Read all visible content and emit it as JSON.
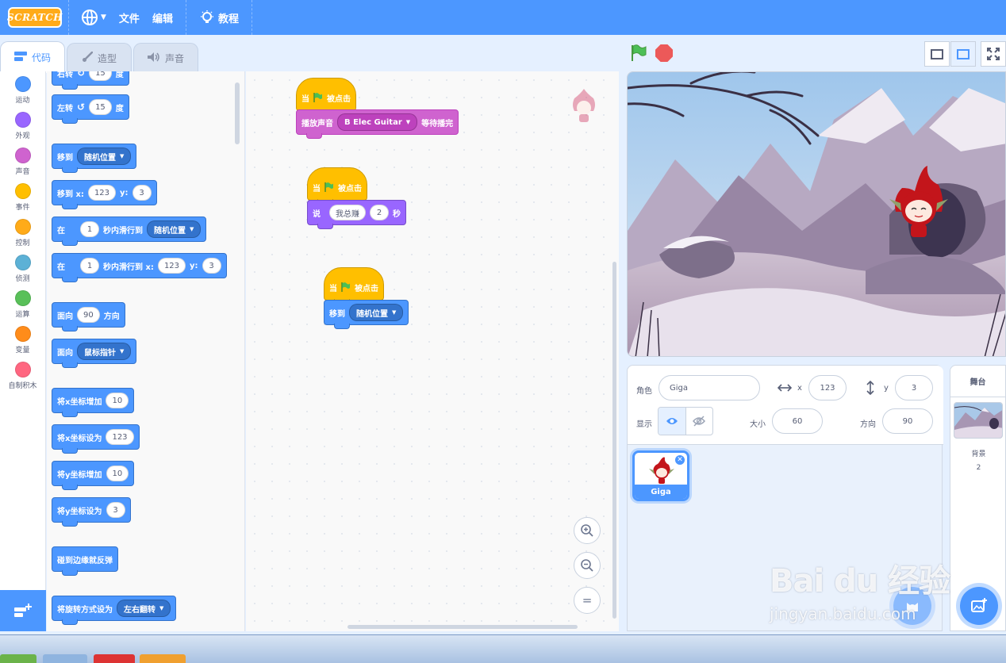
{
  "menubar": {
    "logo": "SCRATCH",
    "file": "文件",
    "edit": "编辑",
    "tutorials": "教程"
  },
  "tabs": [
    {
      "label": "代码",
      "icon": "code-icon"
    },
    {
      "label": "造型",
      "icon": "brush-icon"
    },
    {
      "label": "声音",
      "icon": "speaker-icon"
    }
  ],
  "categories": [
    {
      "label": "运动",
      "color": "#4c97ff"
    },
    {
      "label": "外观",
      "color": "#9966ff"
    },
    {
      "label": "声音",
      "color": "#cf63cf"
    },
    {
      "label": "事件",
      "color": "#ffbf00"
    },
    {
      "label": "控制",
      "color": "#ffab19"
    },
    {
      "label": "侦测",
      "color": "#5cb1d6"
    },
    {
      "label": "运算",
      "color": "#59c059"
    },
    {
      "label": "变量",
      "color": "#ff8c1a"
    },
    {
      "label": "自制积木",
      "color": "#ff6680"
    }
  ],
  "palette": {
    "turn_right": {
      "pre": "右转",
      "value": "15",
      "post": "度"
    },
    "turn_left": {
      "pre": "左转",
      "value": "15",
      "post": "度"
    },
    "goto_random": {
      "pre": "移到",
      "menu": "随机位置"
    },
    "goto_xy": {
      "pre": "移到 x:",
      "x": "123",
      "ylabel": "y:",
      "y": "3"
    },
    "glide_random": {
      "pre": "在",
      "secs": "1",
      "mid": "秒内滑行到",
      "menu": "随机位置"
    },
    "glide_xy": {
      "pre": "在",
      "secs": "1",
      "mid": "秒内滑行到 x:",
      "x": "123",
      "ylabel": "y:",
      "y": "3"
    },
    "point_dir": {
      "pre": "面向",
      "value": "90",
      "post": "方向"
    },
    "point_toward": {
      "pre": "面向",
      "menu": "鼠标指针"
    },
    "change_x": {
      "pre": "将x坐标增加",
      "value": "10"
    },
    "set_x": {
      "pre": "将x坐标设为",
      "value": "123"
    },
    "change_y": {
      "pre": "将y坐标增加",
      "value": "10"
    },
    "set_y": {
      "pre": "将y坐标设为",
      "value": "3"
    },
    "bounce": {
      "label": "碰到边缘就反弹"
    },
    "rotation_style": {
      "pre": "将旋转方式设为",
      "menu": "左右翻转"
    }
  },
  "scripts": [
    {
      "hat": {
        "pre": "当",
        "post": "被点击"
      },
      "block": {
        "pre": "播放声音",
        "menu": "B Elec Guitar",
        "post": "等待播完"
      }
    },
    {
      "hat": {
        "pre": "当",
        "post": "被点击"
      },
      "block": {
        "pre": "说",
        "text": "我总赚",
        "secs": "2",
        "post": "秒"
      }
    },
    {
      "hat": {
        "pre": "当",
        "post": "被点击"
      },
      "block": {
        "pre": "移到",
        "menu": "随机位置"
      }
    }
  ],
  "zoom": {
    "in": "zoom-in-icon",
    "out": "zoom-out-icon",
    "reset": "="
  },
  "sprite_info": {
    "sprite_label": "角色",
    "sprite_name": "Giga",
    "x_label": "x",
    "x": "123",
    "y_label": "y",
    "y": "3",
    "show_label": "显示",
    "size_label": "大小",
    "size": "60",
    "direction_label": "方向",
    "direction": "90"
  },
  "sprites": [
    {
      "name": "Giga"
    }
  ],
  "stage_pane": {
    "title": "舞台",
    "backdrop_label": "背景",
    "backdrop_count": "2"
  },
  "watermark": {
    "main": "Bai du 经验",
    "sub": "jingyan.baidu.com"
  },
  "colors": {
    "accent": "#4c97ff",
    "motion": "#4c97ff",
    "looks": "#9966ff",
    "sound": "#cf63cf",
    "event": "#ffbf00",
    "stop": "#ec5959",
    "flag": "#4cbf56"
  }
}
